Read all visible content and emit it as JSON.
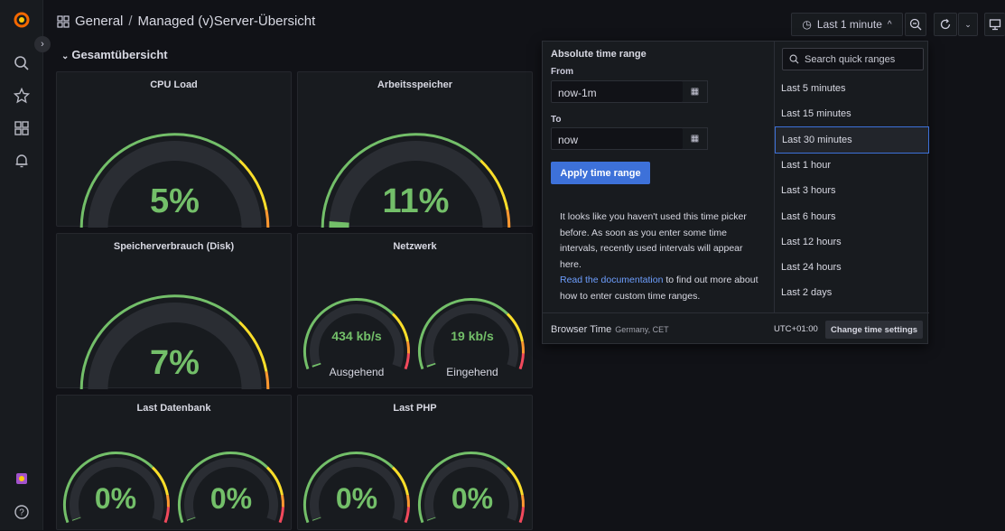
{
  "breadcrumb": {
    "folder": "General",
    "separator": "/",
    "dashboard": "Managed (v)Server-Übersicht"
  },
  "toolbar": {
    "time_range_label": "Last 1 minute"
  },
  "row": {
    "title": "Gesamtübersicht"
  },
  "panels": {
    "cpu": {
      "title": "CPU Load",
      "value": "5%",
      "fraction": 0.05
    },
    "memory": {
      "title": "Arbeitsspeicher",
      "value": "11%",
      "fraction": 0.11
    },
    "disk": {
      "title": "Speicherverbrauch (Disk)",
      "value": "7%",
      "fraction": 0.07
    },
    "network": {
      "title": "Netzwerk",
      "out": {
        "value": "434 kb/s",
        "label": "Ausgehend"
      },
      "in": {
        "value": "19 kb/s",
        "label": "Eingehend"
      }
    },
    "db": {
      "title": "Last Datenbank",
      "values": [
        "0%",
        "0%"
      ]
    },
    "php": {
      "title": "Last PHP",
      "values": [
        "0%",
        "0%"
      ]
    }
  },
  "time_picker": {
    "header": "Absolute time range",
    "from_label": "From",
    "from_value": "now-1m",
    "to_label": "To",
    "to_value": "now",
    "apply_label": "Apply time range",
    "help_text": "It looks like you haven't used this time picker before. As soon as you enter some time intervals, recently used intervals will appear here.",
    "doc_link": "Read the documentation",
    "help_suffix": " to find out more about how to enter custom time ranges.",
    "search_placeholder": "Search quick ranges",
    "quick_ranges": [
      "Last 5 minutes",
      "Last 15 minutes",
      "Last 30 minutes",
      "Last 1 hour",
      "Last 3 hours",
      "Last 6 hours",
      "Last 12 hours",
      "Last 24 hours",
      "Last 2 days"
    ],
    "selected_range": "Last 30 minutes",
    "footer_label": "Browser Time",
    "footer_location": "Germany, CET",
    "utc_offset": "UTC+01:00",
    "change_settings": "Change time settings"
  },
  "colors": {
    "green": "#73bf69",
    "yellow": "#fade2a",
    "orange": "#ff9830",
    "red": "#f2495c",
    "track": "#2a2d33",
    "accent": "#3d71d9"
  }
}
